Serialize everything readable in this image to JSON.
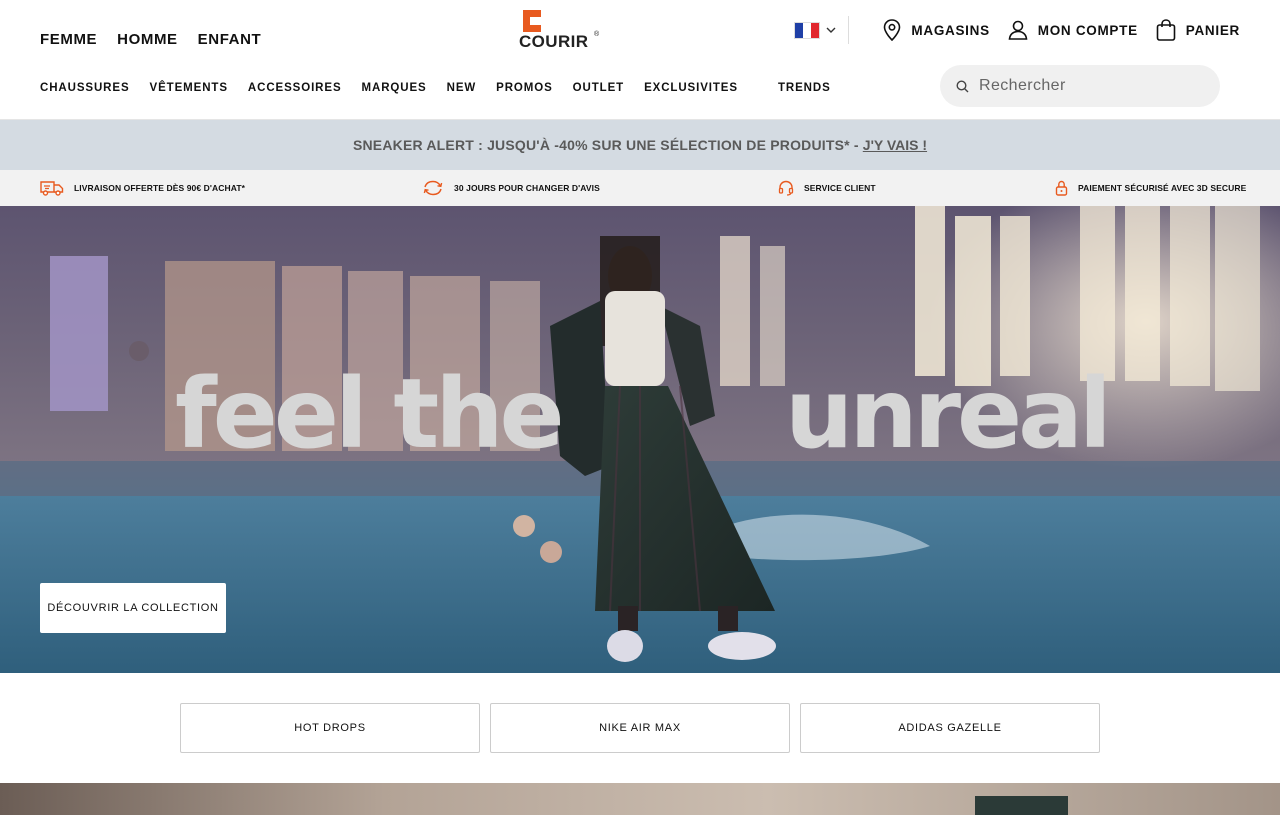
{
  "header": {
    "gender_nav": [
      "FEMME",
      "HOMME",
      "ENFANT"
    ],
    "logo": {
      "text": "COURIR",
      "mark": "®"
    },
    "language": {
      "icon": "flag-fr",
      "colors": [
        "#1f3fa6",
        "#ffffff",
        "#e1272d"
      ]
    },
    "utility": {
      "stores_label": "MAGASINS",
      "account_label": "MON COMPTE",
      "cart_label": "PANIER"
    },
    "categories": [
      "CHAUSSURES",
      "VÊTEMENTS",
      "ACCESSOIRES",
      "MARQUES",
      "NEW",
      "PROMOS",
      "OUTLET",
      "EXCLUSIVITES",
      "TRENDS"
    ],
    "search": {
      "placeholder": "Rechercher",
      "value": ""
    }
  },
  "promo": {
    "text": "SNEAKER ALERT : JUSQU'À -40% SUR UNE SÉLECTION DE PRODUITS* -",
    "link": "J'Y VAIS !"
  },
  "reassurance": [
    {
      "icon": "delivery-truck-icon",
      "label": "LIVRAISON OFFERTE DÈS 90€ D'ACHAT*"
    },
    {
      "icon": "exchange-arrows-icon",
      "label": "30 JOURS POUR CHANGER D'AVIS"
    },
    {
      "icon": "headset-icon",
      "label": "SERVICE CLIENT"
    },
    {
      "icon": "padlock-icon",
      "label": "PAIEMENT SÉCURISÉ AVEC 3D SECURE"
    }
  ],
  "hero": {
    "headline_left": "feel the",
    "headline_right": "unreal",
    "cta": "DÉCOUVRIR LA COLLECTION"
  },
  "quick_links": [
    "HOT DROPS",
    "NIKE AIR MAX",
    "ADIDAS GAZELLE"
  ],
  "colors": {
    "brand_orange": "#e85a1f",
    "promo_bg": "#d4dbe2",
    "reassurance_bg": "#f2f2f2"
  }
}
